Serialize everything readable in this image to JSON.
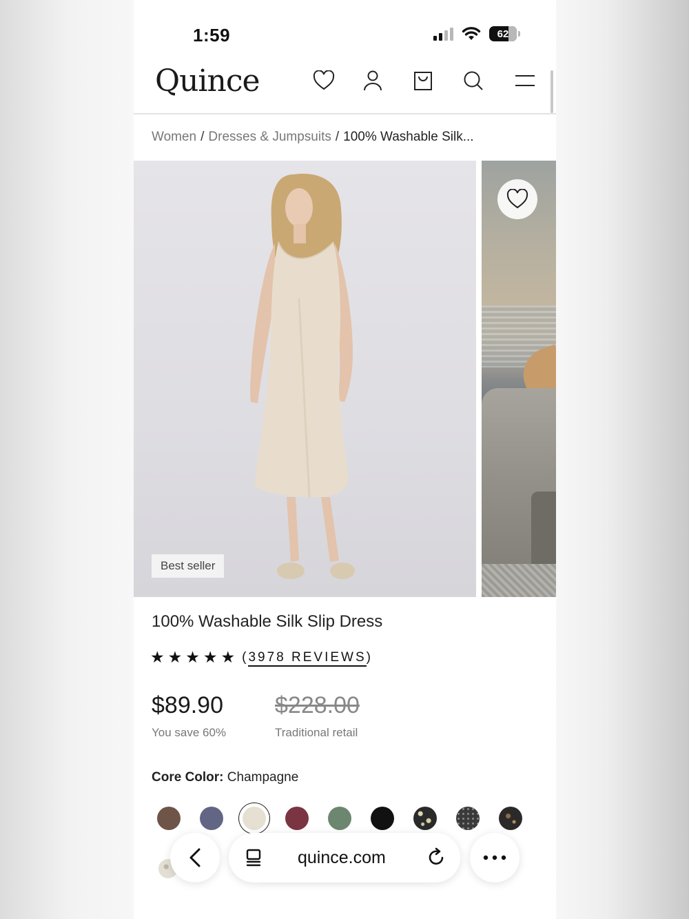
{
  "status_bar": {
    "time": "1:59",
    "battery": "62"
  },
  "header": {
    "logo": "Quince",
    "icons": [
      "heart-icon",
      "account-icon",
      "bag-icon",
      "search-icon",
      "menu-icon"
    ]
  },
  "breadcrumb": {
    "items": [
      "Women",
      "Dresses & Jumpsuits",
      "100% Washable Silk..."
    ],
    "separator": "/"
  },
  "gallery": {
    "badge": "Best seller"
  },
  "product": {
    "title": "100% Washable Silk Slip Dress",
    "rating_stars": 5,
    "reviews_open": "(",
    "reviews_count": "3978 REVIEWS",
    "reviews_close": ")",
    "price": "$89.90",
    "savings": "You save 60%",
    "retail_price": "$228.00",
    "retail_label": "Traditional retail",
    "color_label": "Core Color:",
    "color_value": "Champagne",
    "swatches": [
      {
        "color": "#6e5548",
        "style": "solid"
      },
      {
        "color": "#636585",
        "style": "solid"
      },
      {
        "color": "#e6e0d2",
        "style": "solid",
        "selected": true
      },
      {
        "color": "#7b3542",
        "style": "solid"
      },
      {
        "color": "#6d8670",
        "style": "solid"
      },
      {
        "color": "#111111",
        "style": "solid"
      },
      {
        "color": "#2a2a2a",
        "style": "pattern"
      },
      {
        "color": "#3a3a3a",
        "style": "dots"
      },
      {
        "color": "#2c2a28",
        "style": "mottled"
      }
    ]
  },
  "browser": {
    "url": "quince.com"
  }
}
